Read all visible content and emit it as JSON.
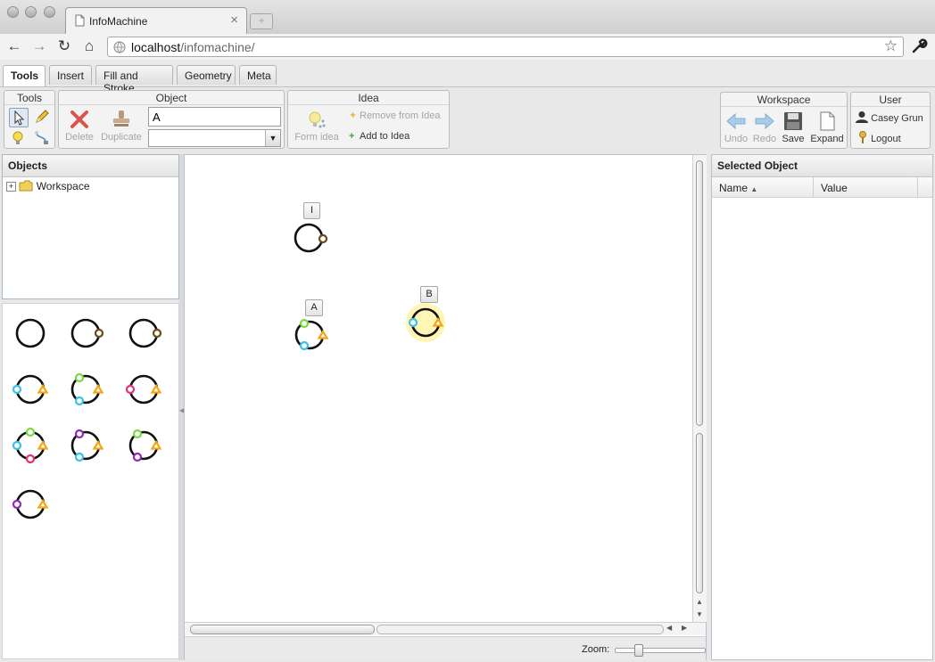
{
  "browser": {
    "tab_title": "InfoMachine",
    "url_host": "localhost",
    "url_path": "/infomachine/"
  },
  "app_tabs": [
    {
      "label": "Tools",
      "active": true
    },
    {
      "label": "Insert",
      "active": false
    },
    {
      "label": "Fill and Stroke",
      "active": false
    },
    {
      "label": "Geometry",
      "active": false
    },
    {
      "label": "Meta",
      "active": false
    }
  ],
  "toolbar": {
    "tools": {
      "title": "Tools"
    },
    "object": {
      "title": "Object",
      "delete_label": "Delete",
      "duplicate_label": "Duplicate",
      "name_value": "A",
      "select_value": ""
    },
    "idea": {
      "title": "Idea",
      "form_idea_label": "Form idea",
      "remove_label": "Remove from Idea",
      "add_label": "Add to Idea"
    },
    "workspace": {
      "title": "Workspace",
      "undo_label": "Undo",
      "redo_label": "Redo",
      "save_label": "Save",
      "expand_label": "Expand"
    },
    "user": {
      "title": "User",
      "user_name": "Casey Grun",
      "logout_label": "Logout"
    }
  },
  "objects_panel": {
    "title": "Objects",
    "tree": [
      {
        "label": "Workspace",
        "expand_symbol": "+"
      }
    ]
  },
  "canvas": {
    "nodes": [
      {
        "label": "I"
      },
      {
        "label": "A"
      },
      {
        "label": "B"
      }
    ],
    "zoom_label": "Zoom:",
    "zoom_level": 0.25
  },
  "selected_panel": {
    "title": "Selected Object",
    "columns": [
      "Name",
      "Value"
    ],
    "sort_indicator": "▲",
    "rows": []
  },
  "colors": {
    "accent_orange": "#f5a515",
    "port_cyan": "#3cc0ea",
    "port_green": "#7ad942",
    "port_pink": "#e0337d",
    "port_purple": "#8e2bb5",
    "port_brown": "#6b4a1d",
    "selection_glow": "#fff3a8"
  }
}
